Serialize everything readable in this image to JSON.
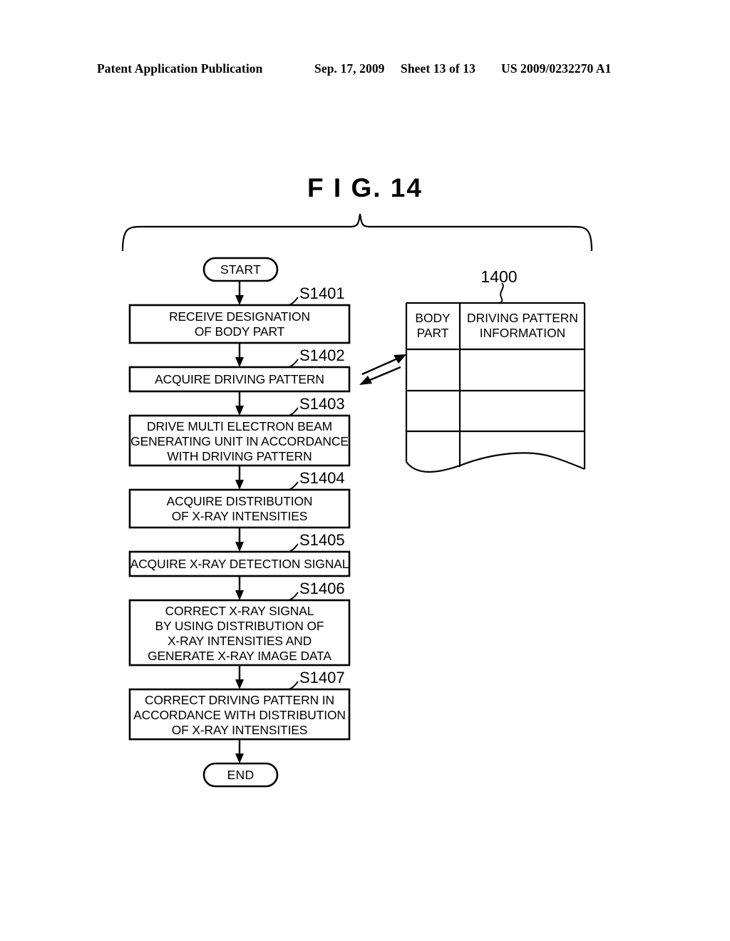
{
  "header": {
    "publication": "Patent Application Publication",
    "date": "Sep. 17, 2009",
    "sheet": "Sheet 13 of 13",
    "patent_number": "US 2009/0232270 A1"
  },
  "figure": {
    "title": "F I G.  14",
    "reference_numeral": "1400"
  },
  "flowchart": {
    "start_label": "START",
    "end_label": "END",
    "steps": [
      {
        "id": "S1401",
        "lines": [
          "RECEIVE DESIGNATION",
          "OF BODY PART"
        ]
      },
      {
        "id": "S1402",
        "lines": [
          "ACQUIRE DRIVING PATTERN"
        ]
      },
      {
        "id": "S1403",
        "lines": [
          "DRIVE MULTI ELECTRON BEAM",
          "GENERATING UNIT IN ACCORDANCE",
          "WITH DRIVING PATTERN"
        ]
      },
      {
        "id": "S1404",
        "lines": [
          "ACQUIRE DISTRIBUTION",
          "OF X-RAY INTENSITIES"
        ]
      },
      {
        "id": "S1405",
        "lines": [
          "ACQUIRE X-RAY DETECTION SIGNAL"
        ]
      },
      {
        "id": "S1406",
        "lines": [
          "CORRECT X-RAY SIGNAL",
          "BY USING DISTRIBUTION OF",
          "X-RAY INTENSITIES AND",
          "GENERATE X-RAY IMAGE DATA"
        ]
      },
      {
        "id": "S1407",
        "lines": [
          "CORRECT DRIVING PATTERN IN",
          "ACCORDANCE WITH DISTRIBUTION",
          "OF X-RAY INTENSITIES"
        ]
      }
    ]
  },
  "table": {
    "columns": [
      {
        "lines": [
          "BODY",
          "PART"
        ]
      },
      {
        "lines": [
          "DRIVING PATTERN",
          "INFORMATION"
        ]
      }
    ],
    "empty_rows": 3
  },
  "colors": {
    "ink": "#000000",
    "paper": "#ffffff"
  }
}
